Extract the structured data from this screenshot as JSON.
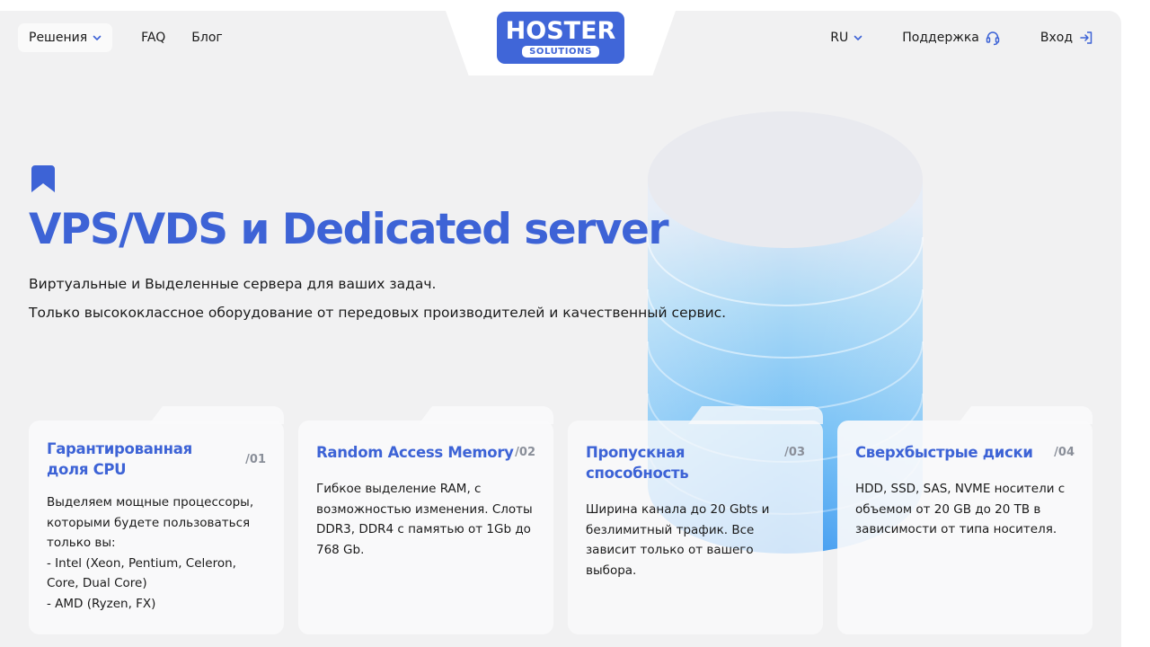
{
  "header": {
    "solutions_label": "Решения",
    "faq_label": "FAQ",
    "blog_label": "Блог",
    "lang_label": "RU",
    "support_label": "Поддержка",
    "login_label": "Вход"
  },
  "logo": {
    "main": "HOSTER",
    "sub": "SOLUTIONS"
  },
  "hero": {
    "title": "VPS/VDS и Dedicated server",
    "line1": "Виртуальные и Выделенные сервера для ваших задач.",
    "line2": "Только высококлассное оборудование от передовых производителей и качественный сервис."
  },
  "cards": [
    {
      "title": "Гарантированная доля CPU",
      "num": "/01",
      "lines": [
        "Выделяем мощные процессоры, которыми будете пользоваться только вы:",
        "- Intel (Xeon, Pentium, Celeron, Core, Dual Core)",
        "- AMD (Ryzen, FX)"
      ]
    },
    {
      "title": "Random Access Memory",
      "num": "/02",
      "lines": [
        "Гибкое выделение RAM, с возможностью изменения. Слоты DDR3, DDR4 с памятью от 1Gb до 768 Gb."
      ]
    },
    {
      "title": "Пропускная способность",
      "num": "/03",
      "lines": [
        "Ширина канала до 20 Gbts и безлимитный трафик. Все зависит только от вашего выбора."
      ]
    },
    {
      "title": "Сверхбыстрые диски",
      "num": "/04",
      "lines": [
        "HDD, SSD, SAS, NVME носители с объемом от 20 GB до 20 TB в зависимости от типа носителя."
      ]
    }
  ],
  "colors": {
    "brand": "#3d63d6",
    "background": "#f1f1f2",
    "card": "#fafafb"
  },
  "icons": [
    "chevron-down-icon",
    "headset-icon",
    "login-icon",
    "bookmark-icon",
    "server-cylinder-illustration"
  ]
}
